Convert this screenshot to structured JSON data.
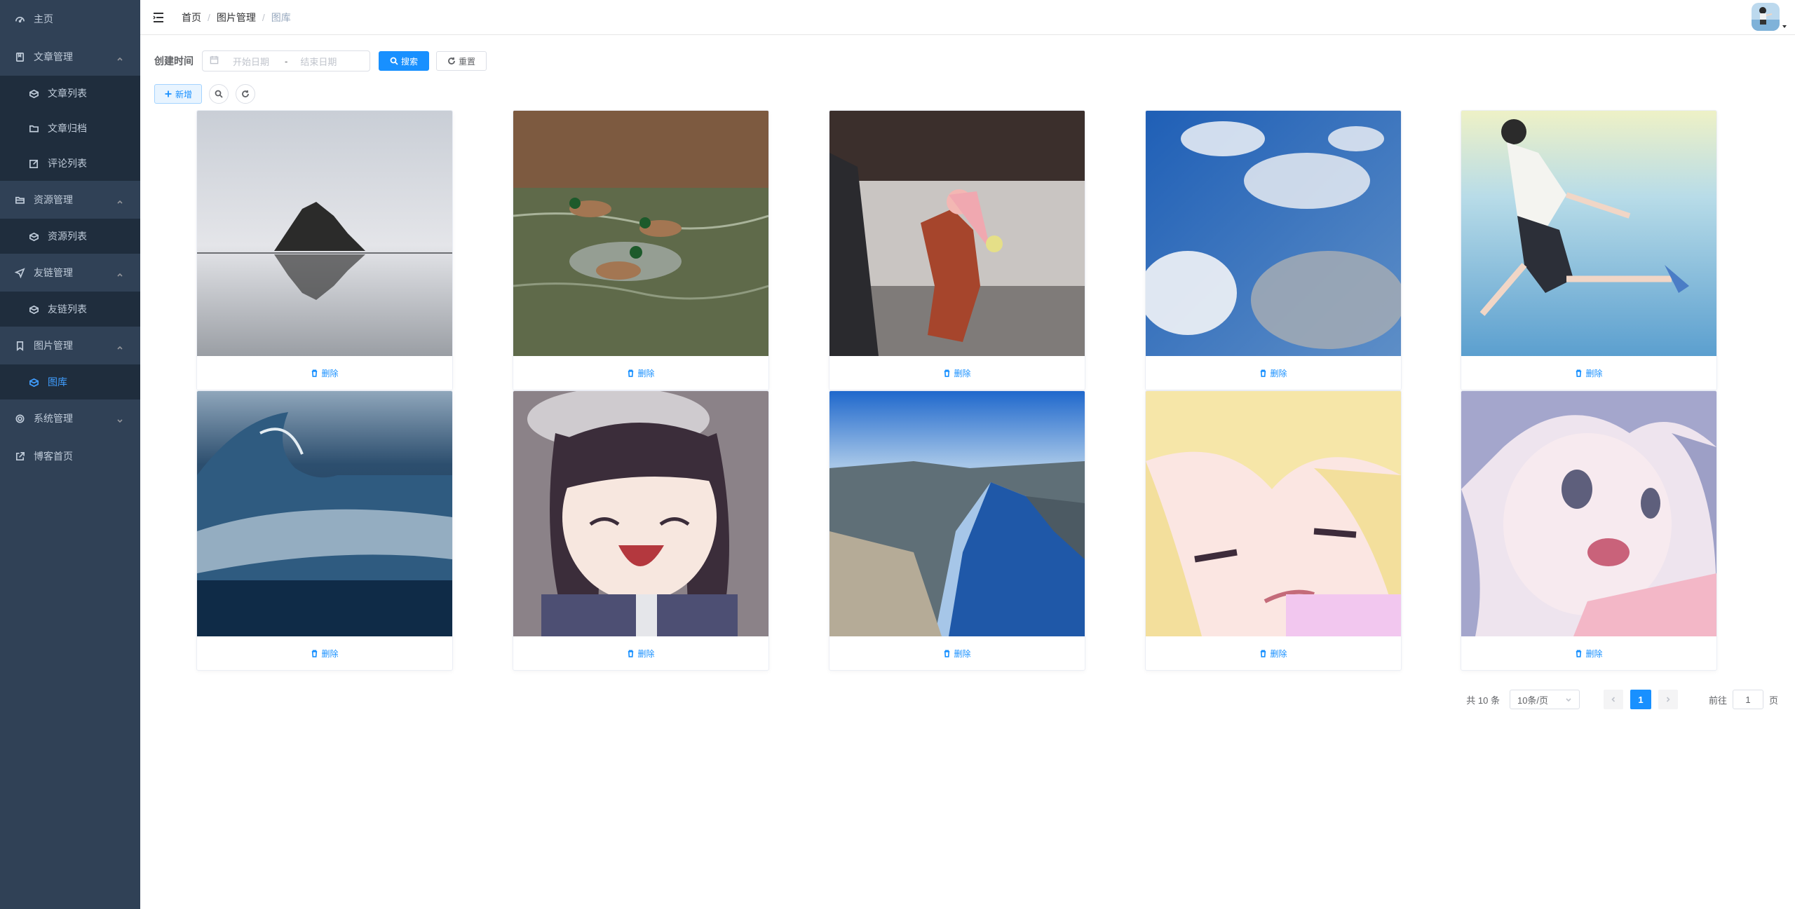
{
  "sidebar": {
    "items": [
      {
        "label": "主页",
        "icon": "dashboard-icon"
      },
      {
        "label": "文章管理",
        "icon": "book-icon",
        "expanded": true,
        "children": [
          {
            "label": "文章列表",
            "icon": "list-icon"
          },
          {
            "label": "文章归档",
            "icon": "folder-icon"
          },
          {
            "label": "评论列表",
            "icon": "edit-icon"
          }
        ]
      },
      {
        "label": "资源管理",
        "icon": "folder-icon",
        "expanded": true,
        "children": [
          {
            "label": "资源列表",
            "icon": "list-icon"
          }
        ]
      },
      {
        "label": "友链管理",
        "icon": "send-icon",
        "expanded": true,
        "children": [
          {
            "label": "友链列表",
            "icon": "list-icon"
          }
        ]
      },
      {
        "label": "图片管理",
        "icon": "bookmark-icon",
        "expanded": true,
        "children": [
          {
            "label": "图库",
            "icon": "gallery-icon",
            "active": true
          }
        ]
      },
      {
        "label": "系统管理",
        "icon": "gear-icon",
        "expanded": false
      },
      {
        "label": "博客首页",
        "icon": "external-link-icon"
      }
    ],
    "colors": {
      "bg": "#304156",
      "sub_bg": "#1f2d3d",
      "text": "#bfcbd9",
      "active": "#409eff"
    }
  },
  "navbar": {
    "breadcrumb": [
      "首页",
      "图片管理",
      "图库"
    ]
  },
  "search": {
    "label": "创建时间",
    "start_placeholder": "开始日期",
    "range_separator": "-",
    "end_placeholder": "结束日期",
    "search_button": "搜索",
    "reset_button": "重置"
  },
  "toolbar": {
    "add_button": "新增"
  },
  "gallery": {
    "delete_label": "删除",
    "images": [
      {
        "subject": "rock island reflection"
      },
      {
        "subject": "ducks on water"
      },
      {
        "subject": "anime girl running with flowers"
      },
      {
        "subject": "blue sky with clouds"
      },
      {
        "subject": "anime boy jumping over sea"
      },
      {
        "subject": "ocean wave"
      },
      {
        "subject": "anime girl smiling"
      },
      {
        "subject": "fjord landscape"
      },
      {
        "subject": "anime blonde girl"
      },
      {
        "subject": "anime girl surprised"
      }
    ]
  },
  "pagination": {
    "total_text": "共 10 条",
    "page_size": "10条/页",
    "current_page": "1",
    "goto_prefix": "前往",
    "goto_value": "1",
    "goto_suffix": "页"
  },
  "colors": {
    "primary": "#1890ff"
  }
}
